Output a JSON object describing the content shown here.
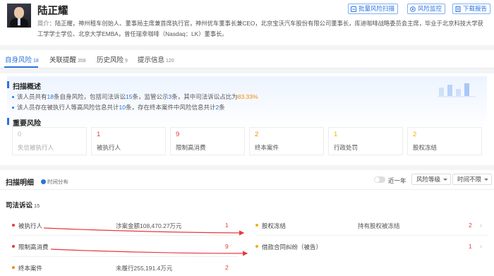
{
  "person": {
    "name": "陆正耀",
    "intro_label": "简介：",
    "intro_text": "陆正耀，神州租车创始人、董事局主席兼首席执行官，神州优车董事长兼CEO，北京宝沃汽车股份有限公司董事长，库迪咖啡战略委员会主席，毕业于北京科技大学获工学学士学位、北京大学EMBA，曾任瑞幸咖啡（Nasdaq：LK）董事长。"
  },
  "header_buttons": [
    {
      "label": "批量风险扫描",
      "icon": "scan-icon"
    },
    {
      "label": "风险监控",
      "icon": "monitor-icon"
    },
    {
      "label": "下载报告",
      "icon": "download-icon"
    }
  ],
  "tabs": [
    {
      "label": "自身风险",
      "count": "18",
      "active": true
    },
    {
      "label": "关联提醒",
      "count": "358"
    },
    {
      "label": "历史风险",
      "count": "9"
    },
    {
      "label": "提示信息",
      "count": "120"
    }
  ],
  "summary": {
    "title": "扫描概述",
    "line1": {
      "p1": "该人员共有",
      "n1": "18",
      "p2": "条自身风险，包括司法诉讼",
      "n2": "15",
      "p3": "条，监管公示",
      "n3": "3",
      "p4": "条，其中司法诉讼占比为",
      "pct": "83.33%"
    },
    "line2": {
      "p1": "该人员存在被执行人等高风险信息共计",
      "n1": "10",
      "p2": "条，存在终本案件中风险信息共计",
      "n2": "2",
      "p3": "条"
    },
    "key_risk_title": "重要风险",
    "cards": [
      {
        "num": "0",
        "label": "失信被执行人",
        "color": "gray"
      },
      {
        "num": "1",
        "label": "被执行人",
        "color": "red"
      },
      {
        "num": "9",
        "label": "限制高消费",
        "color": "red"
      },
      {
        "num": "2",
        "label": "终本案件",
        "color": "orange"
      },
      {
        "num": "1",
        "label": "行政处罚",
        "color": "yellow"
      },
      {
        "num": "2",
        "label": "股权冻结",
        "color": "yellow"
      }
    ]
  },
  "details": {
    "title": "扫描明细",
    "timeline": "时间分布",
    "toggle_label": "近一年",
    "dropdowns": [
      "风险等级",
      "时间不限"
    ],
    "category": {
      "label": "司法诉讼",
      "count": "15"
    },
    "left_rows": [
      {
        "label": "被执行人",
        "mid": "涉案金额108,470.27万元",
        "count": "1",
        "dot": "#e6393b"
      },
      {
        "label": "限制高消费",
        "mid": "",
        "count": "9",
        "dot": "#e6393b"
      },
      {
        "label": "终本案件",
        "mid": "未履行255,191.4万元",
        "count": "2",
        "dot": "#f08c00"
      }
    ],
    "right_rows": [
      {
        "label": "股权冻结",
        "mid": "持有股权被冻结",
        "count": "2",
        "dot": "#f2b100"
      },
      {
        "label": "借款合同纠纷（被告）",
        "mid": "",
        "count": "1",
        "dot": "#f2b100"
      }
    ],
    "row_arrow": "›"
  },
  "colors": {
    "accent": "#2a73de",
    "red": "#e6393b",
    "orange": "#f08c00",
    "yellow": "#f2b100"
  }
}
